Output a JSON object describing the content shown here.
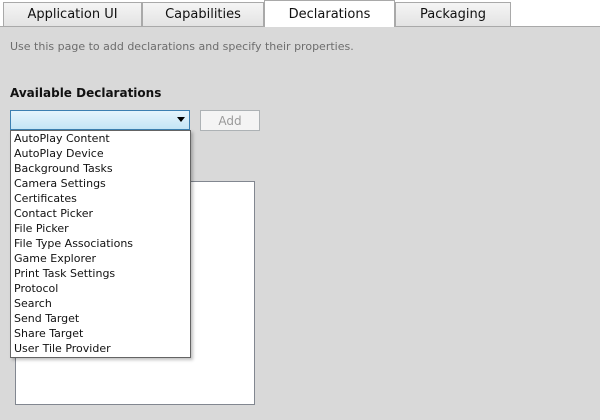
{
  "tabs": [
    {
      "label": "Application UI",
      "active": false
    },
    {
      "label": "Capabilities",
      "active": false
    },
    {
      "label": "Declarations",
      "active": true
    },
    {
      "label": "Packaging",
      "active": false
    }
  ],
  "page": {
    "description": "Use this page to add declarations and specify their properties."
  },
  "declarations": {
    "title": "Available Declarations",
    "selected_value": "",
    "add_label": "Add",
    "options": [
      "AutoPlay Content",
      "AutoPlay Device",
      "Background Tasks",
      "Camera Settings",
      "Certificates",
      "Contact Picker",
      "File Picker",
      "File Type Associations",
      "Game Explorer",
      "Print Task Settings",
      "Protocol",
      "Search",
      "Send Target",
      "Share Target",
      "User Tile Provider"
    ]
  },
  "colors": {
    "panel_background": "#d9d9d9",
    "combo_highlight": "#c4e5f6",
    "combo_border": "#3c7fb1"
  }
}
